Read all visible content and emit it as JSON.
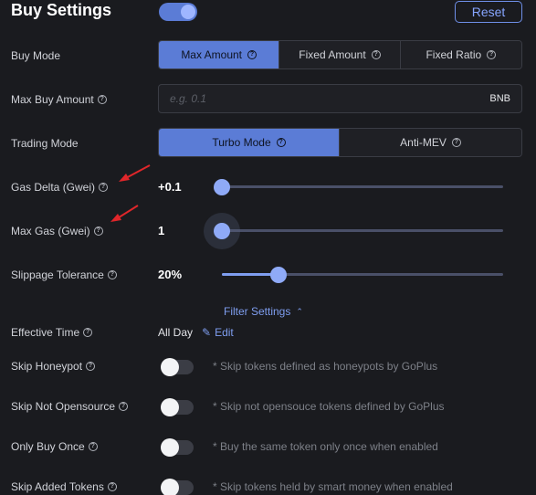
{
  "header": {
    "title": "Buy Settings",
    "master_enabled": true,
    "reset_label": "Reset"
  },
  "help_glyph": "?",
  "buy_mode": {
    "label": "Buy Mode",
    "options": [
      "Max Amount",
      "Fixed Amount",
      "Fixed Ratio"
    ],
    "selected": "Max Amount"
  },
  "max_buy_amount": {
    "label": "Max Buy Amount",
    "value": "",
    "placeholder": "e.g. 0.1",
    "unit": "BNB"
  },
  "trading_mode": {
    "label": "Trading Mode",
    "options": [
      "Turbo Mode",
      "Anti-MEV"
    ],
    "selected": "Turbo Mode"
  },
  "gas_delta": {
    "label": "Gas Delta (Gwei)",
    "value": "+0.1",
    "slider_fraction": 0.0
  },
  "max_gas": {
    "label": "Max Gas (Gwei)",
    "value": "1",
    "slider_fraction": 0.0
  },
  "slippage": {
    "label": "Slippage Tolerance",
    "value": "20%",
    "slider_fraction": 0.2
  },
  "filter_settings": {
    "label": "Filter Settings",
    "expanded": true
  },
  "effective_time": {
    "label": "Effective Time",
    "value": "All Day",
    "edit_label": "Edit"
  },
  "filters": [
    {
      "label": "Skip Honeypot",
      "enabled": false,
      "hint": "* Skip tokens defined as honeypots by GoPlus"
    },
    {
      "label": "Skip Not Opensource",
      "enabled": false,
      "hint": "* Skip not opensouce tokens defined by GoPlus"
    },
    {
      "label": "Only Buy Once",
      "enabled": false,
      "hint": "* Buy the same token only once when enabled"
    },
    {
      "label": "Skip Added Tokens",
      "enabled": false,
      "hint": "* Skip tokens held by smart money when enabled"
    }
  ],
  "colors": {
    "accent": "#5b7cd6",
    "link": "#7f9ef0",
    "annotation_arrow": "#e0262a",
    "background": "#1a1b1f"
  }
}
